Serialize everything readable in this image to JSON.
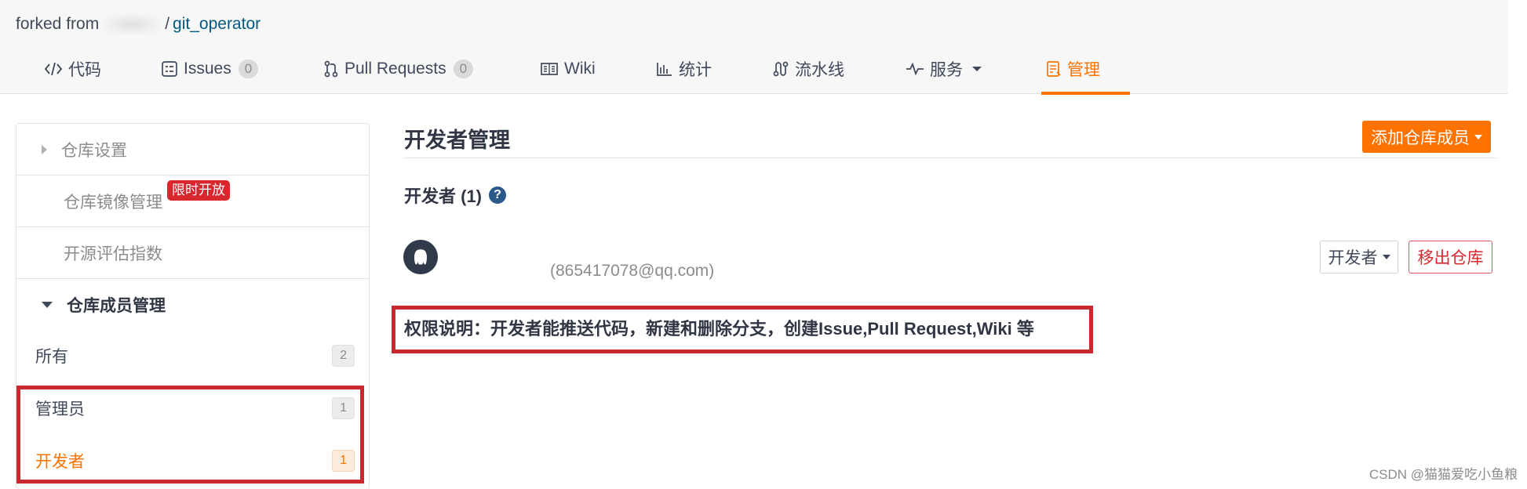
{
  "header": {
    "forked_from_label": "forked from",
    "repo_separator": "/",
    "repo_name": "git_operator"
  },
  "tabs": [
    {
      "label": "代码",
      "icon": "code-icon"
    },
    {
      "label": "Issues",
      "icon": "issues-icon",
      "count": "0"
    },
    {
      "label": "Pull Requests",
      "icon": "pull-request-icon",
      "count": "0"
    },
    {
      "label": "Wiki",
      "icon": "wiki-icon"
    },
    {
      "label": "统计",
      "icon": "stats-icon"
    },
    {
      "label": "流水线",
      "icon": "pipeline-icon"
    },
    {
      "label": "服务",
      "icon": "service-icon"
    },
    {
      "label": "管理",
      "icon": "manage-icon",
      "active": true
    }
  ],
  "sidebar": {
    "repo_settings": "仓库设置",
    "mirror_manage": "仓库镜像管理",
    "mirror_badge": "限时开放",
    "open_source_index": "开源评估指数",
    "member_manage": "仓库成员管理",
    "roles": [
      {
        "label": "所有",
        "count": "2"
      },
      {
        "label": "管理员",
        "count": "1"
      },
      {
        "label": "开发者",
        "count": "1",
        "active": true
      }
    ]
  },
  "main": {
    "title": "开发者管理",
    "add_member_button": "添加仓库成员",
    "developers_heading": "开发者 (1)",
    "help_icon_glyph": "?",
    "member": {
      "email": "(865417078@qq.com)",
      "role": "开发者",
      "remove_button": "移出仓库"
    },
    "permission_note": "权限说明：开发者能推送代码，新建和删除分支，创建Issue,Pull Request,Wiki 等"
  },
  "watermark": "CSDN @猫猫爱吃小鱼粮",
  "colors": {
    "accent": "#fe7300",
    "danger": "#d9272e",
    "annotation_box": "#c8282e",
    "link": "#005980"
  }
}
